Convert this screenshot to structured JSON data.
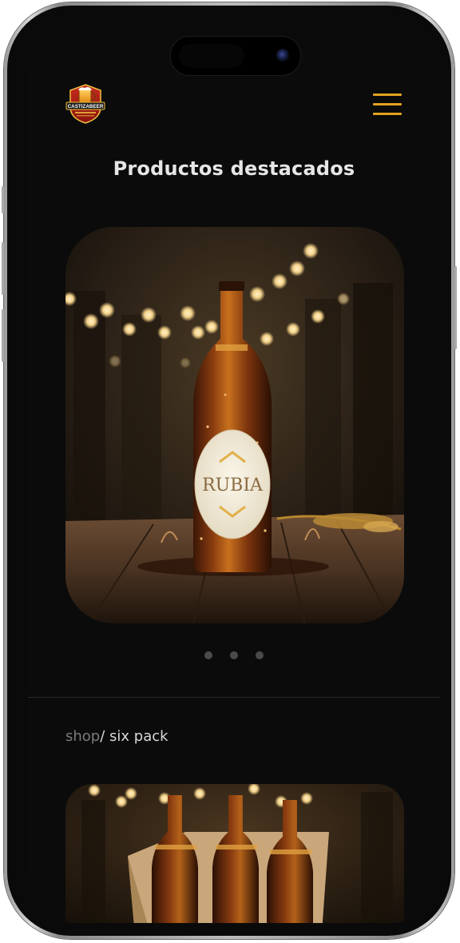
{
  "header": {
    "brand_name": "CASTIZABEER",
    "menu_icon": "hamburger-menu-icon",
    "accent_color": "#e3a320"
  },
  "featured": {
    "title": "Productos destacados",
    "product": {
      "label_text": "RUBIA"
    },
    "carousel": {
      "total_slides": 3
    }
  },
  "breadcrumb": {
    "shop": "shop",
    "separator": "/ ",
    "current": "six pack"
  },
  "colors": {
    "background": "#0b0b0b",
    "title": "#e6e6e6",
    "muted": "#7b7b7b"
  }
}
